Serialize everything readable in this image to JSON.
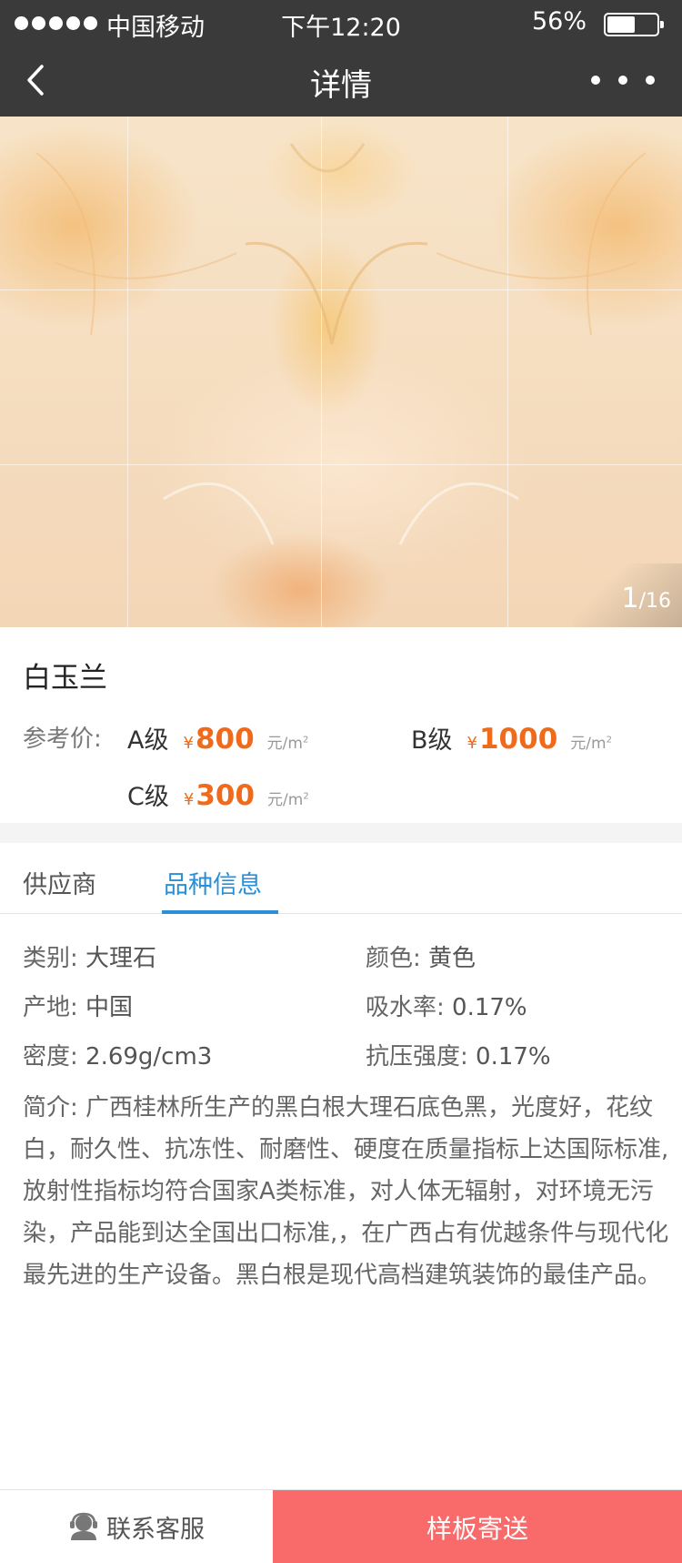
{
  "status_bar": {
    "carrier": "中国移动",
    "time": "下午12:20",
    "battery_percent": "56%",
    "battery_level": 0.56
  },
  "nav": {
    "title": "详情",
    "back_icon": "chevron-left-icon",
    "more_icon": "more-dots-icon"
  },
  "gallery": {
    "current": "1",
    "total": "/16"
  },
  "product": {
    "name": "白玉兰",
    "price_label": "参考价:",
    "currency_symbol": "¥",
    "unit": "元/m",
    "unit_sup": "2",
    "grades": [
      {
        "label": "A级",
        "price": "800"
      },
      {
        "label": "B级",
        "price": "1000"
      },
      {
        "label": "C级",
        "price": "300"
      }
    ],
    "price_color": "#f06a1c"
  },
  "tabs": [
    {
      "label": "供应商",
      "active": false
    },
    {
      "label": "品种信息",
      "active": true
    }
  ],
  "info": {
    "category": {
      "key": "类别:",
      "value": "大理石"
    },
    "color": {
      "key": "颜色:",
      "value": "黄色"
    },
    "origin": {
      "key": "产地:",
      "value": "中国"
    },
    "absorption": {
      "key": "吸水率:",
      "value": "0.17%"
    },
    "density": {
      "key": "密度:",
      "value": "2.69g/cm3"
    },
    "strength": {
      "key": "抗压强度:",
      "value": "0.17%"
    },
    "description": "简介:  广西桂林所生产的黑白根大理石底色黑，光度好，花纹白，耐久性、抗冻性、耐磨性、硬度在质量指标上达国际标准,放射性指标均符合国家A类标准，对人体无辐射，对环境无污染，产品能到达全国出口标准,，在广西占有优越条件与现代化最先进的生产设备。黑白根是现代高档建筑装饰的最佳产品。"
  },
  "bottom_bar": {
    "service_label": "联系客服",
    "service_icon": "customer-service-icon",
    "send_label": "样板寄送",
    "send_color": "#f96a6a"
  },
  "colors": {
    "nav_bg": "#3a3a3a",
    "accent": "#2a8fd4"
  }
}
